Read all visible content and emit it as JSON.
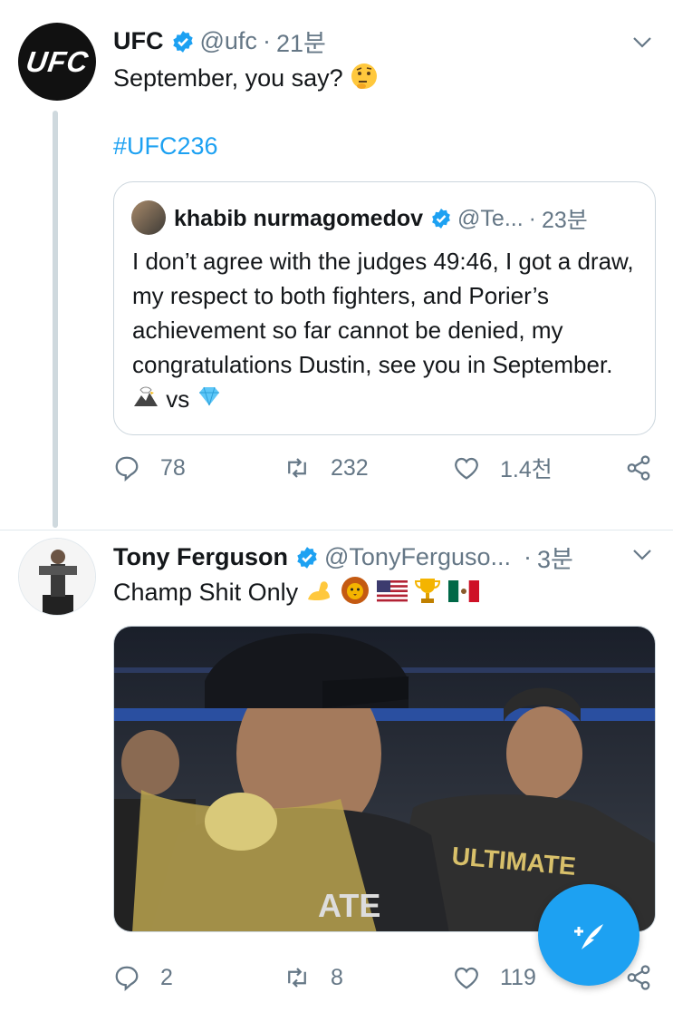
{
  "tweets": [
    {
      "name": "UFC",
      "handle": "@ufc",
      "dot": "·",
      "time": "21분",
      "avatar_text": "UFC",
      "text": "September, you say?",
      "hashtag": "#UFC236",
      "quote": {
        "name": "khabib nurmagomedov",
        "handle": "@Te...",
        "dot": "·",
        "time": "23분",
        "text": "I don’t agree with the judges 49:46, I got  a draw, my respect to both fighters, and Porier’s achievement so far cannot be denied, my congratulations Dustin, see you in September.",
        "vs": "vs"
      },
      "actions": {
        "replies": "78",
        "retweets": "232",
        "likes": "1.4천"
      }
    },
    {
      "name": "Tony Ferguson",
      "handle": "@TonyFerguso...",
      "dot": "·",
      "time": "3분",
      "text": "Champ Shit Only",
      "actions": {
        "replies": "2",
        "retweets": "8",
        "likes": "119"
      }
    }
  ],
  "colors": {
    "accent": "#1da1f2",
    "secondary_text": "#657786",
    "border": "#ccd6dd"
  },
  "icons": [
    "verified-badge-icon",
    "chevron-down-icon",
    "reply-icon",
    "retweet-icon",
    "like-icon",
    "share-icon",
    "compose-icon"
  ]
}
